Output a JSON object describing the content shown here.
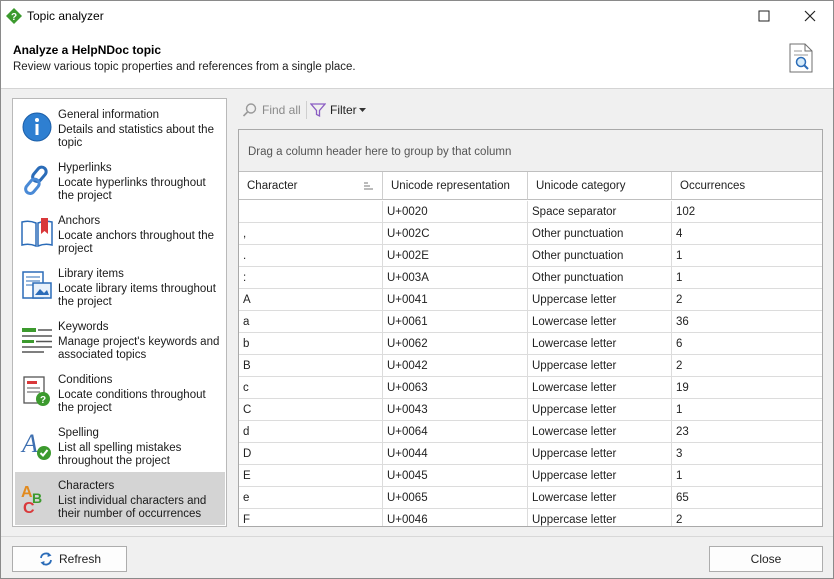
{
  "window": {
    "title": "Topic analyzer"
  },
  "header": {
    "title": "Analyze a HelpNDoc topic",
    "subtitle": "Review various topic properties and references from a single place."
  },
  "sidebar": {
    "items": [
      {
        "title": "General information",
        "desc": "Details and statistics about the topic",
        "icon": "info-icon"
      },
      {
        "title": "Hyperlinks",
        "desc": "Locate hyperlinks throughout the project",
        "icon": "link-icon"
      },
      {
        "title": "Anchors",
        "desc": "Locate anchors throughout the project",
        "icon": "book-anchor-icon"
      },
      {
        "title": "Library items",
        "desc": "Locate library items throughout the project",
        "icon": "library-icon"
      },
      {
        "title": "Keywords",
        "desc": "Manage project's keywords and associated topics",
        "icon": "keywords-icon"
      },
      {
        "title": "Conditions",
        "desc": "Locate conditions throughout the project",
        "icon": "conditions-icon"
      },
      {
        "title": "Spelling",
        "desc": "List all spelling mistakes throughout the project",
        "icon": "spelling-icon"
      },
      {
        "title": "Characters",
        "desc": "List individual characters and their number of occurrences",
        "icon": "characters-icon",
        "selected": true
      }
    ]
  },
  "toolbar": {
    "find_label": "Find all",
    "filter_label": "Filter"
  },
  "grid": {
    "group_hint": "Drag a column header here to group by that column",
    "columns": [
      "Character",
      "Unicode representation",
      "Unicode category",
      "Occurrences"
    ],
    "rows": [
      [
        "",
        "U+0020",
        "Space separator",
        "102"
      ],
      [
        ",",
        "U+002C",
        "Other punctuation",
        "4"
      ],
      [
        ".",
        "U+002E",
        "Other punctuation",
        "1"
      ],
      [
        ":",
        "U+003A",
        "Other punctuation",
        "1"
      ],
      [
        "A",
        "U+0041",
        "Uppercase letter",
        "2"
      ],
      [
        "a",
        "U+0061",
        "Lowercase letter",
        "36"
      ],
      [
        "b",
        "U+0062",
        "Lowercase letter",
        "6"
      ],
      [
        "B",
        "U+0042",
        "Uppercase letter",
        "2"
      ],
      [
        "c",
        "U+0063",
        "Lowercase letter",
        "19"
      ],
      [
        "C",
        "U+0043",
        "Uppercase letter",
        "1"
      ],
      [
        "d",
        "U+0064",
        "Lowercase letter",
        "23"
      ],
      [
        "D",
        "U+0044",
        "Uppercase letter",
        "3"
      ],
      [
        "E",
        "U+0045",
        "Uppercase letter",
        "1"
      ],
      [
        "e",
        "U+0065",
        "Lowercase letter",
        "65"
      ],
      [
        "F",
        "U+0046",
        "Uppercase letter",
        "2"
      ]
    ]
  },
  "buttons": {
    "refresh": "Refresh",
    "close": "Close"
  },
  "colors": {
    "accent_green": "#3c9a2e",
    "icon_blue": "#2b6cb8",
    "selected_bg": "#d4d4d4"
  }
}
